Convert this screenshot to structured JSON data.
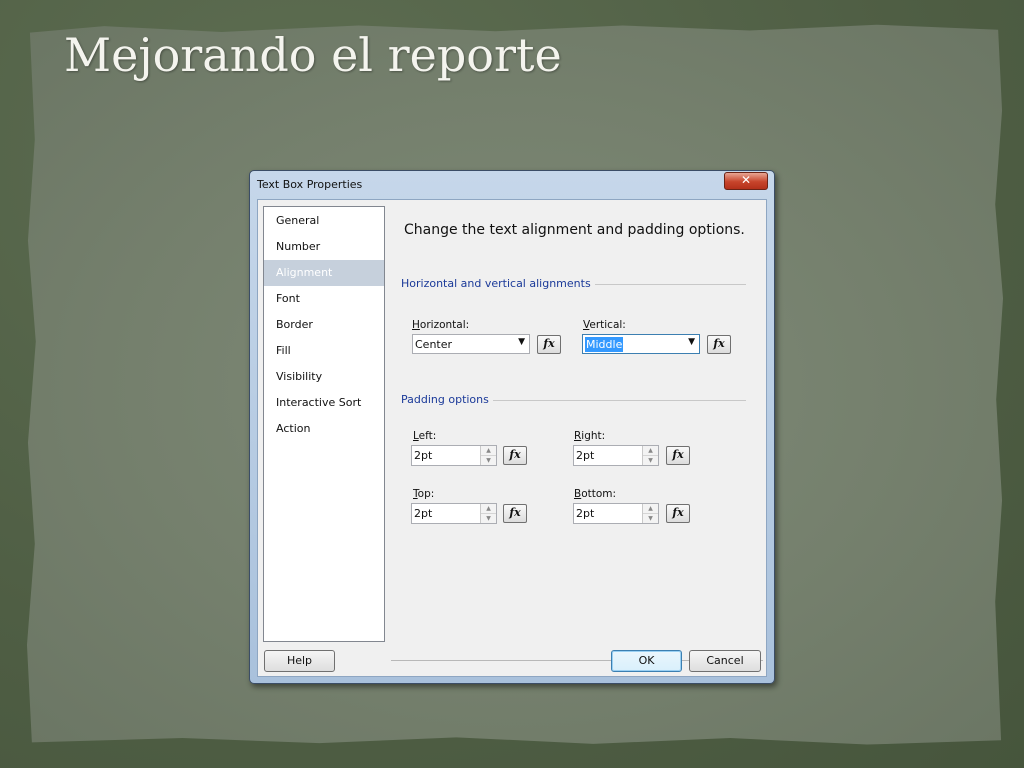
{
  "slide": {
    "title": "Mejorando el reporte"
  },
  "dialog": {
    "title": "Text Box Properties",
    "close_glyph": "✕",
    "nav_items": [
      "General",
      "Number",
      "Alignment",
      "Font",
      "Border",
      "Fill",
      "Visibility",
      "Interactive Sort",
      "Action"
    ],
    "selected_nav": "Alignment",
    "intro": "Change the text alignment and padding options.",
    "alignment_group": "Horizontal and vertical alignments",
    "horizontal": {
      "label": "Horizontal:",
      "value": "Center"
    },
    "vertical": {
      "label": "Vertical:",
      "value": "Middle"
    },
    "padding_group": "Padding options",
    "padding": {
      "left": {
        "label": "Left:",
        "value": "2pt"
      },
      "right": {
        "label": "Right:",
        "value": "2pt"
      },
      "top": {
        "label": "Top:",
        "value": "2pt"
      },
      "bottom": {
        "label": "Bottom:",
        "value": "2pt"
      }
    },
    "fx_label": "fx",
    "buttons": {
      "help": "Help",
      "ok": "OK",
      "cancel": "Cancel"
    }
  },
  "colors": {
    "group_heading": "#1b3a99",
    "close_button": "#c7442b",
    "selection": "#3399ff"
  }
}
